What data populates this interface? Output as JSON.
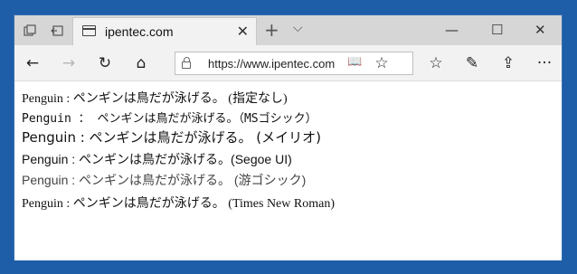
{
  "tab": {
    "title": "ipentec.com",
    "close": "✕"
  },
  "newtab": "+",
  "tabchev": "⌵",
  "window_controls": {
    "minimize": "—",
    "maximize": "☐",
    "close": "✕"
  },
  "nav": {
    "back": "←",
    "forward": "→",
    "refresh": "↻",
    "home": "⌂"
  },
  "address": {
    "url": "https://www.ipentec.com",
    "reader": "📖",
    "favorite": "☆"
  },
  "toolbar": {
    "favorites_hub": "☆",
    "notes": "✎",
    "share": "⇪",
    "more": "···"
  },
  "content": {
    "lines": [
      "Penguin : ペンギンは鳥だが泳げる。 (指定なし)",
      "Penguin ： ペンギンは鳥だが泳げる。（MSゴシック）",
      "Penguin : ペンギンは鳥だが泳げる。 (メイリオ)",
      "Penguin : ペンギンは鳥だが泳げる。(Segoe UI)",
      "Penguin : ペンギンは鳥だが泳げる。 (游ゴシック)",
      "Penguin : ペンギンは鳥だが泳げる。 (Times New Roman)"
    ]
  }
}
